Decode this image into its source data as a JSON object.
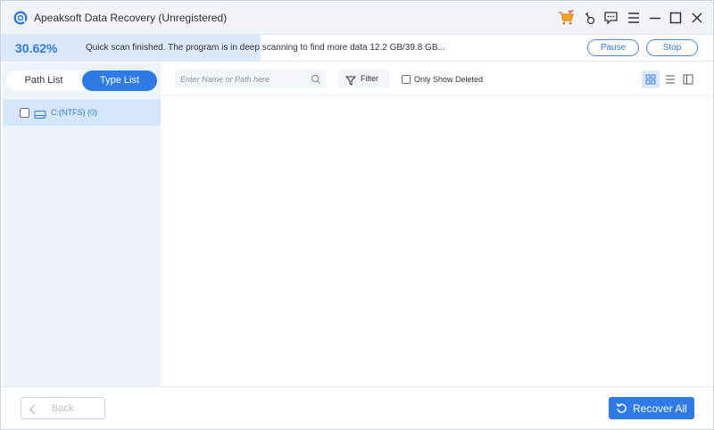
{
  "window": {
    "title": "Apeaksoft Data Recovery (Unregistered)",
    "icons": [
      "app-logo-icon",
      "shopping-cart-icon",
      "key-icon",
      "feedback-icon",
      "menu-icon",
      "minimize-icon",
      "maximize-icon",
      "close-icon"
    ]
  },
  "scan": {
    "progress_text": "30.62%",
    "progress_value": 30.62,
    "message": "Quick scan finished. The program is in deep scanning to find more data 12.2 GB/39.8 GB...",
    "pause_label": "Pause",
    "stop_label": "Stop"
  },
  "sidebar": {
    "tabs": [
      {
        "label": "Path List",
        "active": false
      },
      {
        "label": "Type List",
        "active": true
      }
    ],
    "tree": [
      {
        "label": "C:(NTFS) (0)",
        "checked": false,
        "icon": "drive-icon"
      }
    ]
  },
  "toolbar": {
    "search_placeholder": "Enter Name or Path here",
    "filter_label": "Filter",
    "only_deleted_label": "Only Show Deleted",
    "only_deleted_checked": false,
    "view_modes": [
      "grid-view-icon",
      "list-view-icon",
      "detail-view-icon"
    ],
    "active_view": "grid-view-icon"
  },
  "footer": {
    "back_label": "Back",
    "recover_label": "Recover All"
  },
  "colors": {
    "accent": "#2f7be6",
    "progress_fill": "#dbe9fb",
    "sidebar_bg": "#eef3fa",
    "selected_row": "#d6e6f9",
    "titlebar_bg": "#f0f4f9"
  }
}
